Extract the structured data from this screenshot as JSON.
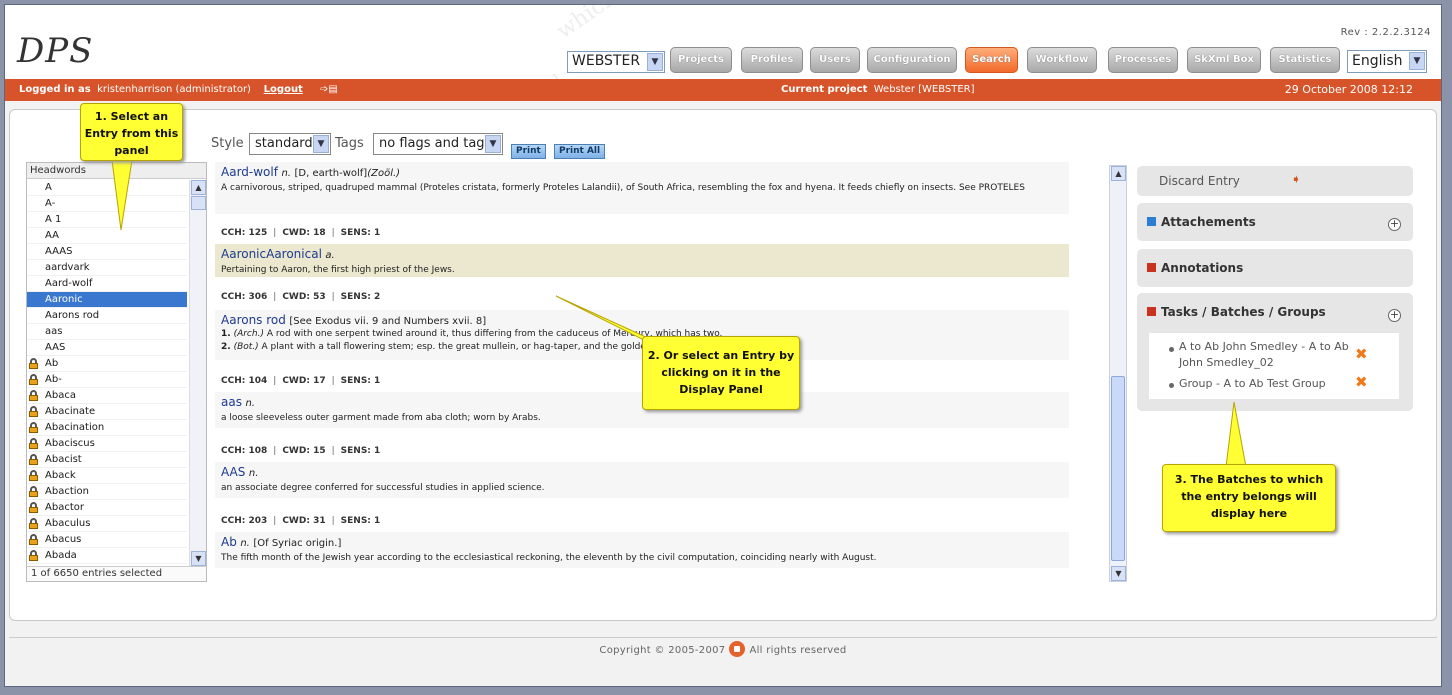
{
  "header": {
    "logo": "DPS",
    "rev": "Rev : 2.2.2.3124",
    "project_select": "WEBSTER",
    "language_select": "English",
    "nav": [
      "Projects",
      "Profiles",
      "Users",
      "Configuration",
      "Search",
      "Workflow",
      "Processes",
      "SkXml Box",
      "Statistics"
    ],
    "active_nav": "Search"
  },
  "topbar": {
    "logged_label": "Logged in as",
    "user": "kristenharrison (administrator)",
    "logout": "Logout",
    "project_label": "Current project",
    "project": "Webster [WEBSTER]",
    "date": "29 October 2008 12:12"
  },
  "toolbar": {
    "style_label": "Style",
    "style_value": "standard",
    "tags_label": "Tags",
    "tags_value": "no flags and tags",
    "print": "Print",
    "print_all": "Print All"
  },
  "headwords": {
    "title": "Headwords",
    "items": [
      "A",
      "A-",
      "A 1",
      "AA",
      "AAAS",
      "aardvark",
      "Aard-wolf",
      "Aaronic",
      "Aarons rod",
      "aas",
      "AAS",
      "Ab",
      "Ab-",
      "Abaca",
      "Abacinate",
      "Abacination",
      "Abaciscus",
      "Abacist",
      "Aback",
      "Abaction",
      "Abactor",
      "Abaculus",
      "Abacus",
      "Abada"
    ],
    "locked_from_index": 11,
    "selected_index": 7,
    "footer": "1 of 6650 entries selected"
  },
  "display": {
    "meta_labels": [
      "CCH:",
      "CWD:",
      "SENS:"
    ],
    "entries": [
      {
        "headword": "Aard-wolf",
        "pos": "n.",
        "etym": "[D, earth-wolf]",
        "label": "(Zoöl.)",
        "def": "A carnivorous, striped, quadruped mammal (Proteles cristata, formerly Proteles Lalandii), of South Africa, resembling the fox and hyena. It feeds chiefly on insects. See PROTELES",
        "meta": [
          "125",
          "18",
          "1"
        ]
      },
      {
        "headword": "AaronicAaronical",
        "pos": "a.",
        "etym": "",
        "label": "",
        "def": "Pertaining to Aaron, the first high priest of the Jews.",
        "meta": [
          "306",
          "53",
          "2"
        ]
      },
      {
        "headword": "Aarons rod",
        "pos": "",
        "etym": "[See Exodus vii. 9 and Numbers xvii. 8]",
        "label": "",
        "def1_num": "1.",
        "def1_label": "(Arch.)",
        "def1": "A rod with one serpent twined around it, thus differing from the caduceus of Mercury, which has two.",
        "def2_num": "2.",
        "def2_label": "(Bot.)",
        "def2": "A plant with a tall flowering stem; esp. the great mullein, or hag-taper, and the golden-rod.",
        "meta": [
          "104",
          "17",
          "1"
        ]
      },
      {
        "headword": "aas",
        "pos": "n.",
        "etym": "",
        "label": "",
        "def": "a loose sleeveless outer garment made from aba cloth; worn by Arabs.",
        "meta": [
          "108",
          "15",
          "1"
        ]
      },
      {
        "headword": "AAS",
        "pos": "n.",
        "etym": "",
        "label": "",
        "def": "an associate degree conferred for successful studies in applied science.",
        "meta": [
          "203",
          "31",
          "1"
        ]
      },
      {
        "headword": "Ab",
        "pos": "n.",
        "etym": "[Of Syriac origin.]",
        "label": "",
        "def": "The fifth month of the Jewish year according to the ecclesiastical reckoning, the eleventh by the civil computation, coinciding nearly with August.",
        "meta": []
      }
    ]
  },
  "right": {
    "discard": "Discard Entry",
    "attachments": "Attachements",
    "annotations": "Annotations",
    "tasks_title": "Tasks / Batches / Groups",
    "tasks": [
      "A to Ab John Smedley - A to Ab John Smedley_02",
      "Group - A to Ab Test Group"
    ],
    "colors": {
      "attachments": "#2a7fd4",
      "annotations": "#c8321e",
      "tasks": "#c8321e"
    }
  },
  "callouts": {
    "c1": "1. Select an Entry from this panel",
    "c2": "2. Or select an Entry by clicking on it in the Display Panel",
    "c3": "3. The Batches to which the entry belongs will display here"
  },
  "footer": {
    "left": "Copyright © 2005-2007",
    "right": "All rights reserved"
  }
}
